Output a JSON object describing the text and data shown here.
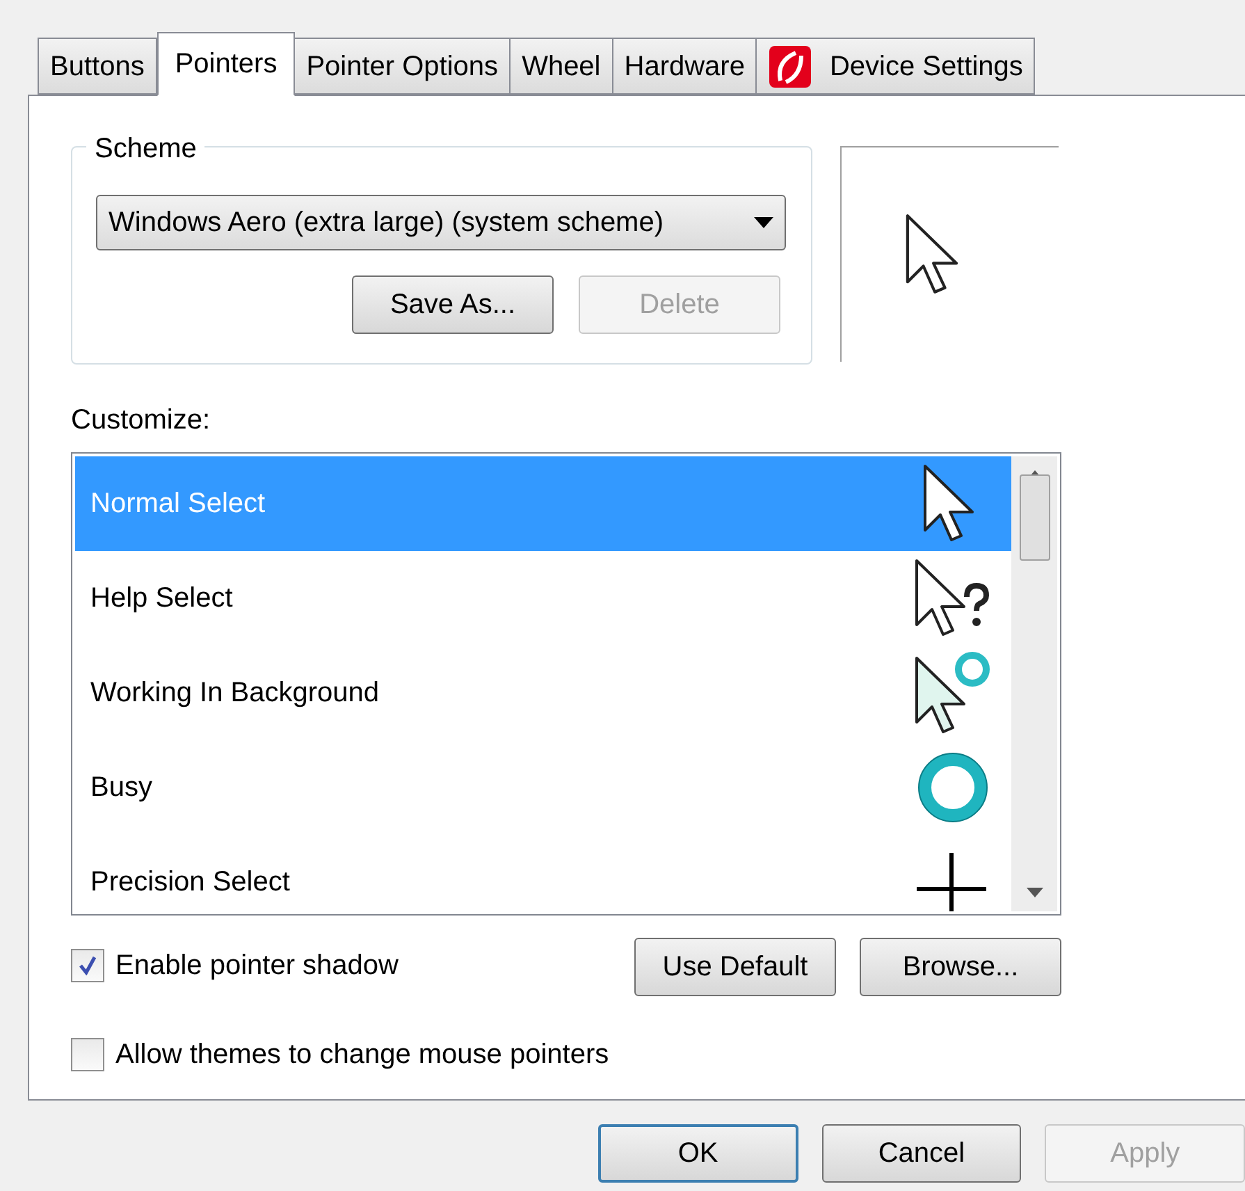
{
  "tabs": [
    {
      "label": "Buttons",
      "selected": false,
      "kind": "plain"
    },
    {
      "label": "Pointers",
      "selected": true,
      "kind": "plain"
    },
    {
      "label": "Pointer Options",
      "selected": false,
      "kind": "plain"
    },
    {
      "label": "Wheel",
      "selected": false,
      "kind": "plain"
    },
    {
      "label": "Hardware",
      "selected": false,
      "kind": "plain"
    },
    {
      "label": "Device Settings",
      "selected": false,
      "kind": "logo"
    }
  ],
  "scheme": {
    "legend": "Scheme",
    "value": "Windows Aero (extra large) (system scheme)",
    "buttons": [
      {
        "label": "Save As...",
        "disabled": false
      },
      {
        "label": "Delete",
        "disabled": true
      }
    ]
  },
  "customize": {
    "label": "Customize:",
    "items": [
      {
        "name": "Normal Select",
        "kind": "arrow",
        "selected": true
      },
      {
        "name": "Help Select",
        "kind": "help",
        "selected": false
      },
      {
        "name": "Working In Background",
        "kind": "working",
        "selected": false
      },
      {
        "name": "Busy",
        "kind": "busy",
        "selected": false
      },
      {
        "name": "Precision Select",
        "kind": "cross",
        "selected": false
      }
    ]
  },
  "options": [
    {
      "label": "Enable pointer shadow",
      "checked": true
    },
    {
      "label": "Allow themes to change mouse pointers",
      "checked": false
    }
  ],
  "list_buttons": [
    {
      "label": "Use Default",
      "disabled": false
    },
    {
      "label": "Browse...",
      "disabled": false
    }
  ],
  "dialog_buttons": [
    {
      "label": "OK",
      "disabled": false,
      "focused": true
    },
    {
      "label": "Cancel",
      "disabled": false,
      "focused": false
    },
    {
      "label": "Apply",
      "disabled": true,
      "focused": false
    }
  ]
}
